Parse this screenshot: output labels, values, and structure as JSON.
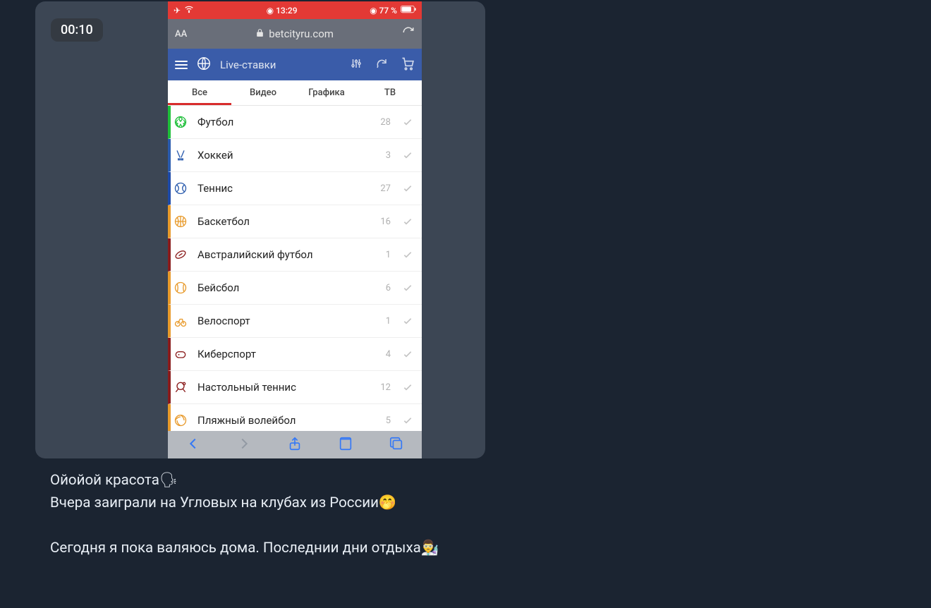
{
  "badge": {
    "time": "00:10"
  },
  "status": {
    "time": "13:29",
    "battery": "77 %"
  },
  "browser": {
    "aa": "AA",
    "url": "betcityru.com"
  },
  "header": {
    "title": "Live-ставки"
  },
  "tabs": [
    {
      "label": "Все"
    },
    {
      "label": "Видео"
    },
    {
      "label": "Графика"
    },
    {
      "label": "ТВ"
    }
  ],
  "sports": [
    {
      "name": "Футбол",
      "count": "28",
      "stripe": "#1fbf3a",
      "iconColor": "#1fbf3a",
      "iconKind": "soccer"
    },
    {
      "name": "Хоккей",
      "count": "3",
      "stripe": "#2a5bad",
      "iconColor": "#2a5bad",
      "iconKind": "hockey"
    },
    {
      "name": "Теннис",
      "count": "27",
      "stripe": "#1e4aa8",
      "iconColor": "#2a5bad",
      "iconKind": "tennis"
    },
    {
      "name": "Баскетбол",
      "count": "16",
      "stripe": "#e89a2b",
      "iconColor": "#e89a2b",
      "iconKind": "basketball"
    },
    {
      "name": "Австралийский футбол",
      "count": "1",
      "stripe": "#8a1c1c",
      "iconColor": "#8a1c1c",
      "iconKind": "rugby"
    },
    {
      "name": "Бейсбол",
      "count": "6",
      "stripe": "#e89a2b",
      "iconColor": "#e89a2b",
      "iconKind": "baseball"
    },
    {
      "name": "Велоспорт",
      "count": "1",
      "stripe": "#e89a2b",
      "iconColor": "#e89a2b",
      "iconKind": "cycling"
    },
    {
      "name": "Киберспорт",
      "count": "4",
      "stripe": "#8a1c1c",
      "iconColor": "#8a1c1c",
      "iconKind": "esport"
    },
    {
      "name": "Настольный теннис",
      "count": "12",
      "stripe": "#8a1c1c",
      "iconColor": "#8a1c1c",
      "iconKind": "pingpong"
    },
    {
      "name": "Пляжный волейбол",
      "count": "5",
      "stripe": "#e89a2b",
      "iconColor": "#e89a2b",
      "iconKind": "volley"
    }
  ],
  "caption": {
    "line1": "Ойойой красота🗣",
    "line2": "Вчера заиграли на Угловых на клубах из России🤭",
    "line3": "Сегодня я пока валяюсь дома. Последнии дни отдыха👨‍🔬"
  }
}
